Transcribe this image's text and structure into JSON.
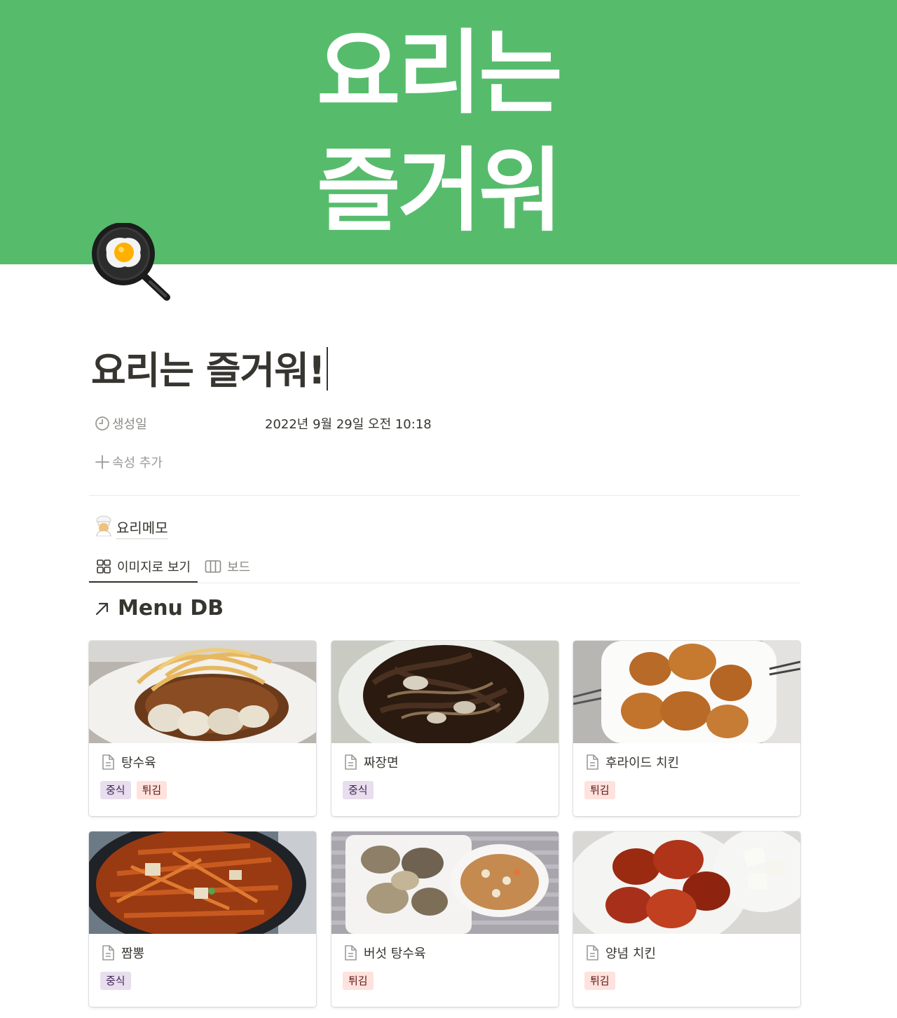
{
  "cover": {
    "line1": "요리는",
    "line2": "즐거워",
    "color": "#56bc6c"
  },
  "page": {
    "icon": "frying-pan-egg-icon",
    "title": "요리는 즐거워!"
  },
  "properties": {
    "created": {
      "name": "생성일",
      "value": "2022년 9월 29일 오전 10:18",
      "icon": "clock-icon"
    },
    "add_label": "속성 추가"
  },
  "database": {
    "icon": "cook-icon",
    "title": "요리메모",
    "tabs": [
      {
        "label": "이미지로 보기",
        "icon": "gallery-icon",
        "active": true
      },
      {
        "label": "보드",
        "icon": "board-icon",
        "active": false
      }
    ],
    "linked_title": "Menu DB",
    "cards": [
      {
        "name": "탕수육",
        "tags": [
          {
            "label": "중식",
            "color": "purple"
          },
          {
            "label": "튀김",
            "color": "red"
          }
        ]
      },
      {
        "name": "짜장면",
        "tags": [
          {
            "label": "중식",
            "color": "purple"
          }
        ]
      },
      {
        "name": "후라이드 치킨",
        "tags": [
          {
            "label": "튀김",
            "color": "red"
          }
        ]
      },
      {
        "name": "짬뽕",
        "tags": [
          {
            "label": "중식",
            "color": "purple"
          }
        ]
      },
      {
        "name": "버섯 탕수육",
        "tags": [
          {
            "label": "튀김",
            "color": "red"
          }
        ]
      },
      {
        "name": "양념 치킨",
        "tags": [
          {
            "label": "튀김",
            "color": "red"
          }
        ]
      }
    ]
  }
}
